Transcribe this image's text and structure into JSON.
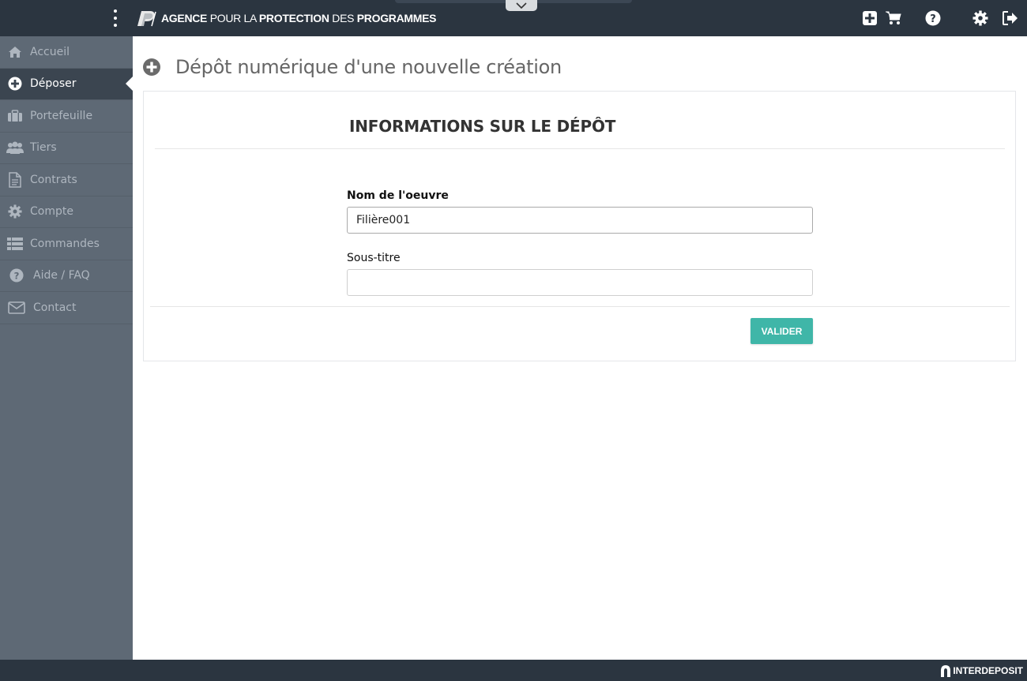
{
  "header": {
    "logo_text_part1": "AGENCE",
    "logo_text_part2": " POUR LA ",
    "logo_text_part3": "PROTECTION",
    "logo_text_part4": " DES ",
    "logo_text_part5": "PROGRAMMES",
    "icons": [
      "menu-kebab-icon",
      "plus-square-icon",
      "shopping-cart-icon",
      "help-circle-icon",
      "gear-icon",
      "logout-icon"
    ]
  },
  "sidebar": {
    "items": [
      {
        "label": "Accueil",
        "icon": "home-icon"
      },
      {
        "label": "Déposer",
        "icon": "plus-circle-icon",
        "active": true
      },
      {
        "label": "Portefeuille",
        "icon": "briefcase-icon"
      },
      {
        "label": "Tiers",
        "icon": "users-icon"
      },
      {
        "label": "Contrats",
        "icon": "document-icon"
      },
      {
        "label": "Compte",
        "icon": "gear-icon"
      },
      {
        "label": "Commandes",
        "icon": "list-icon"
      },
      {
        "label": "Aide / FAQ",
        "icon": "help-circle-icon"
      },
      {
        "label": "Contact",
        "icon": "envelope-icon"
      }
    ]
  },
  "main": {
    "title": "Dépôt numérique d'une nouvelle création",
    "panel_heading": "INFORMATIONS SUR LE DÉPÔT",
    "fields": {
      "name_label": "Nom de l'oeuvre",
      "name_value": "Filière001",
      "subtitle_label": "Sous-titre",
      "subtitle_value": ""
    },
    "submit_label": "VALIDER"
  },
  "footer": {
    "brand": "INTERDEPOSIT"
  },
  "colors": {
    "topbar": "#2b3540",
    "sidebar": "#5e6975",
    "sidebar_active": "#3b4550",
    "accent": "#3fb6a8"
  }
}
